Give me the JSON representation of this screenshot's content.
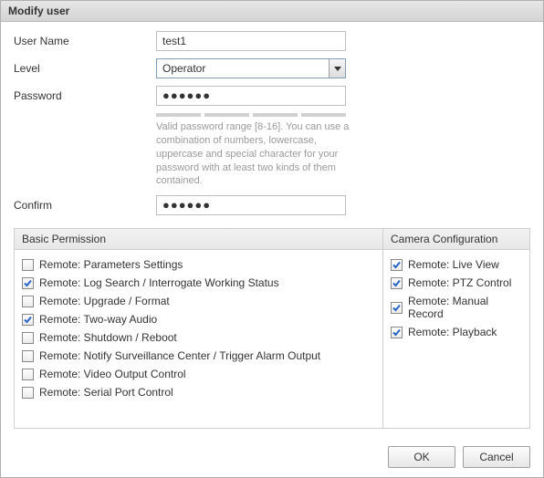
{
  "title": "Modify user",
  "labels": {
    "username": "User Name",
    "level": "Level",
    "password": "Password",
    "confirm": "Confirm"
  },
  "values": {
    "username": "test1",
    "level": "Operator",
    "password_masked": "●●●●●●",
    "confirm_masked": "●●●●●●"
  },
  "password_hint": "Valid password range [8-16]. You can use a combination of numbers, lowercase, uppercase and special character for your password with at least two kinds of them contained.",
  "perm_headers": {
    "basic": "Basic Permission",
    "camera": "Camera Configuration"
  },
  "basic_permissions": [
    {
      "label": "Remote: Parameters Settings",
      "checked": false
    },
    {
      "label": "Remote: Log Search / Interrogate Working Status",
      "checked": true
    },
    {
      "label": "Remote: Upgrade / Format",
      "checked": false
    },
    {
      "label": "Remote: Two-way Audio",
      "checked": true
    },
    {
      "label": "Remote: Shutdown / Reboot",
      "checked": false
    },
    {
      "label": "Remote: Notify Surveillance Center / Trigger Alarm Output",
      "checked": false
    },
    {
      "label": "Remote: Video Output Control",
      "checked": false
    },
    {
      "label": "Remote: Serial Port Control",
      "checked": false
    }
  ],
  "camera_permissions": [
    {
      "label": "Remote: Live View",
      "checked": true
    },
    {
      "label": "Remote: PTZ Control",
      "checked": true
    },
    {
      "label": "Remote: Manual Record",
      "checked": true
    },
    {
      "label": "Remote: Playback",
      "checked": true
    }
  ],
  "buttons": {
    "ok": "OK",
    "cancel": "Cancel"
  }
}
